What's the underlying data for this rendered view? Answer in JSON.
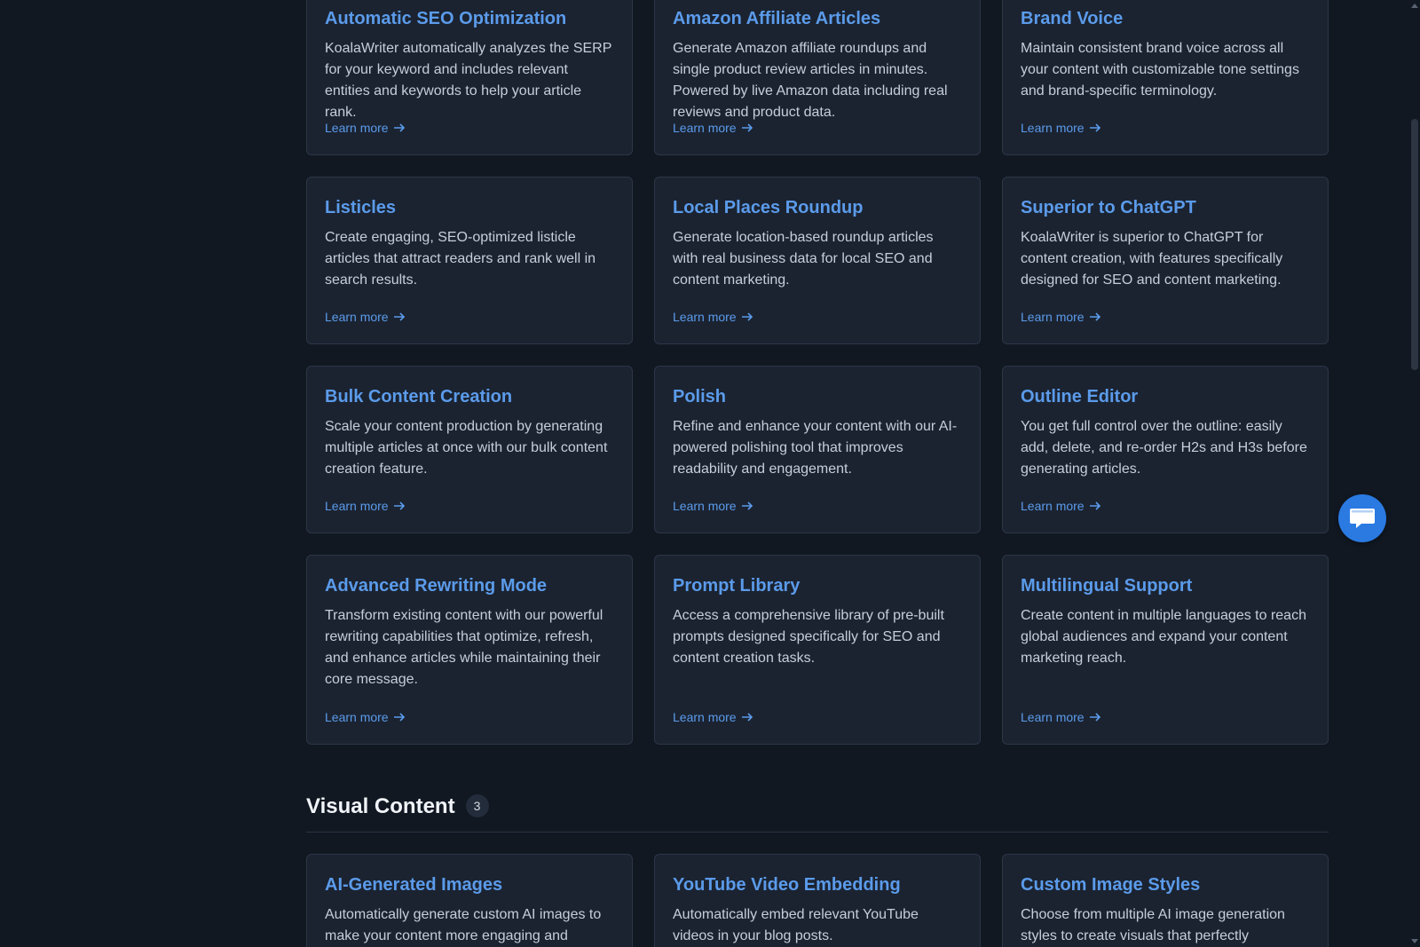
{
  "features": {
    "learn_more_label": "Learn more",
    "cards": [
      {
        "title": "Automatic SEO Optimization",
        "description": "KoalaWriter automatically analyzes the SERP for your keyword and includes relevant entities and keywords to help your article rank.",
        "link": "Learn more"
      },
      {
        "title": "Amazon Affiliate Articles",
        "description": "Generate Amazon affiliate roundups and single product review articles in minutes. Powered by live Amazon data including real reviews and product data.",
        "link": "Learn more"
      },
      {
        "title": "Brand Voice",
        "description": "Maintain consistent brand voice across all your content with customizable tone settings and brand-specific terminology.",
        "link": "Learn more"
      },
      {
        "title": "Listicles",
        "description": "Create engaging, SEO-optimized listicle articles that attract readers and rank well in search results.",
        "link": "Learn more"
      },
      {
        "title": "Local Places Roundup",
        "description": "Generate location-based roundup articles with real business data for local SEO and content marketing.",
        "link": "Learn more"
      },
      {
        "title": "Superior to ChatGPT",
        "description": "KoalaWriter is superior to ChatGPT for content creation, with features specifically designed for SEO and content marketing.",
        "link": "Learn more"
      },
      {
        "title": "Bulk Content Creation",
        "description": "Scale your content production by generating multiple articles at once with our bulk content creation feature.",
        "link": "Learn more"
      },
      {
        "title": "Polish",
        "description": "Refine and enhance your content with our AI-powered polishing tool that improves readability and engagement.",
        "link": "Learn more"
      },
      {
        "title": "Outline Editor",
        "description": "You get full control over the outline: easily add, delete, and re-order H2s and H3s before generating articles.",
        "link": "Learn more"
      },
      {
        "title": "Advanced Rewriting Mode",
        "description": "Transform existing content with our powerful rewriting capabilities that optimize, refresh, and enhance articles while maintaining their core message.",
        "link": "Learn more"
      },
      {
        "title": "Prompt Library",
        "description": "Access a comprehensive library of pre-built prompts designed specifically for SEO and content creation tasks.",
        "link": "Learn more"
      },
      {
        "title": "Multilingual Support",
        "description": "Create content in multiple languages to reach global audiences and expand your content marketing reach.",
        "link": "Learn more"
      }
    ]
  },
  "visual_section": {
    "title": "Visual Content",
    "count": "3",
    "cards": [
      {
        "title": "AI-Generated Images",
        "description": "Automatically generate custom AI images to make your content more engaging and"
      },
      {
        "title": "YouTube Video Embedding",
        "description": "Automatically embed relevant YouTube videos in your blog posts."
      },
      {
        "title": "Custom Image Styles",
        "description": "Choose from multiple AI image generation styles to create visuals that perfectly"
      }
    ]
  },
  "chat_widget": {
    "icon": "chat-bubble-icon"
  },
  "colors": {
    "background": "#111822",
    "card": "#1b2331",
    "accent": "#5b9bea",
    "fab": "#2a7ae2"
  }
}
